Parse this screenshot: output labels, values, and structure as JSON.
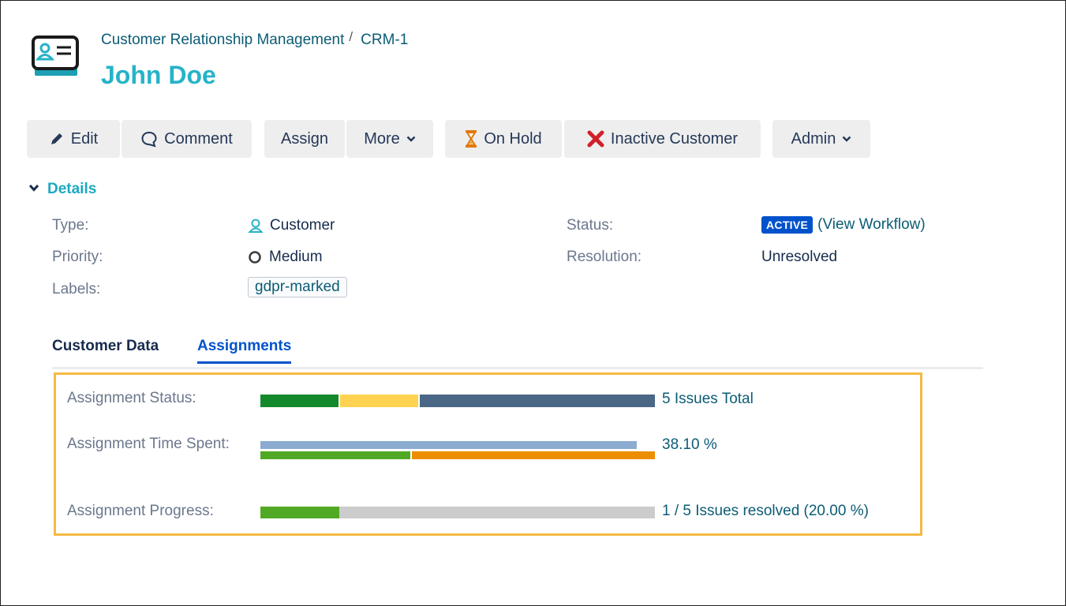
{
  "breadcrumb": {
    "project": "Customer Relationship Management",
    "separator": "/",
    "issue_key": "CRM-1"
  },
  "title": "John Doe",
  "toolbar": {
    "edit": "Edit",
    "comment": "Comment",
    "assign": "Assign",
    "more": "More",
    "on_hold": "On Hold",
    "inactive_customer": "Inactive Customer",
    "admin": "Admin"
  },
  "details": {
    "heading": "Details",
    "type_label": "Type:",
    "type_value": "Customer",
    "priority_label": "Priority:",
    "priority_value": "Medium",
    "labels_label": "Labels:",
    "labels_value": "gdpr-marked",
    "status_label": "Status:",
    "status_value": "ACTIVE",
    "view_workflow": "(View Workflow)",
    "resolution_label": "Resolution:",
    "resolution_value": "Unresolved"
  },
  "tabs": [
    {
      "label": "Customer Data",
      "active": false
    },
    {
      "label": "Assignments",
      "active": true
    }
  ],
  "assignments": {
    "status_label": "Assignment Status:",
    "status_summary": "5 Issues Total",
    "status_segments": [
      {
        "state": "done",
        "count": 1,
        "color": "#14892c"
      },
      {
        "state": "in-progress",
        "count": 1,
        "color": "#ffd351"
      },
      {
        "state": "to-do",
        "count": 3,
        "color": "#4a6785"
      }
    ],
    "time_label": "Assignment Time Spent:",
    "time_percent": "38.10 %",
    "time_colors": {
      "estimate": "#8cabd0",
      "logged": "#51a825",
      "remaining": "#ec8e00"
    },
    "progress_label": "Assignment Progress:",
    "progress_summary": "1 / 5 Issues resolved (20.00 %)",
    "progress_fraction": 0.2,
    "progress_colors": {
      "done": "#51a825",
      "rest": "#cccccc"
    }
  },
  "colors": {
    "accent": "#26b3c8",
    "link": "#0b5c75",
    "active_tab": "#0052cc",
    "panel_border": "#f5b943"
  }
}
